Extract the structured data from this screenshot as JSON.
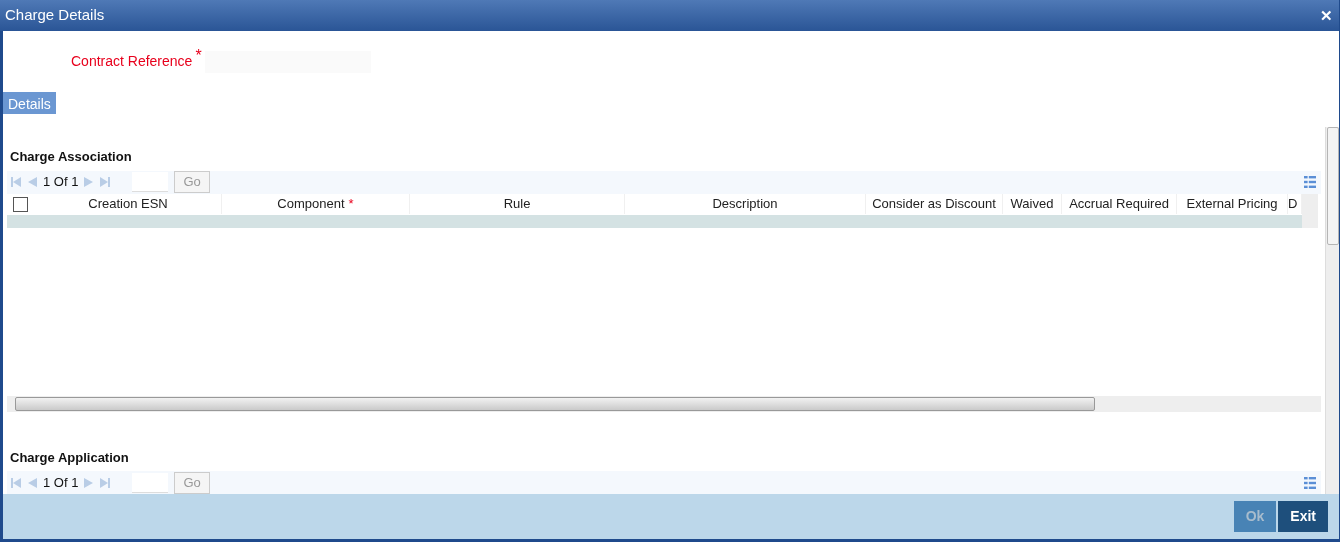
{
  "window": {
    "title": "Charge Details",
    "close": "✕"
  },
  "contract_reference": {
    "label": "Contract Reference",
    "required_mark": "*"
  },
  "tabs": [
    {
      "label": "Details",
      "selected": true
    }
  ],
  "sections": [
    {
      "title": "Charge Association",
      "pagination": "1 Of 1",
      "go": "Go",
      "select_all_checked": false,
      "columns": [
        {
          "label": "Creation ESN"
        },
        {
          "label": "Component",
          "required_mark": "*"
        },
        {
          "label": "Rule"
        },
        {
          "label": "Description"
        },
        {
          "label": "Consider as Discount"
        },
        {
          "label": "Waived"
        },
        {
          "label": "Accrual Required"
        },
        {
          "label": "External Pricing"
        },
        {
          "label": "D"
        }
      ]
    },
    {
      "title": "Charge Application",
      "pagination": "1 Of 1",
      "go": "Go"
    }
  ],
  "buttons": [
    {
      "label": "Ok",
      "disabled": true
    },
    {
      "label": "Exit",
      "disabled": false
    }
  ]
}
